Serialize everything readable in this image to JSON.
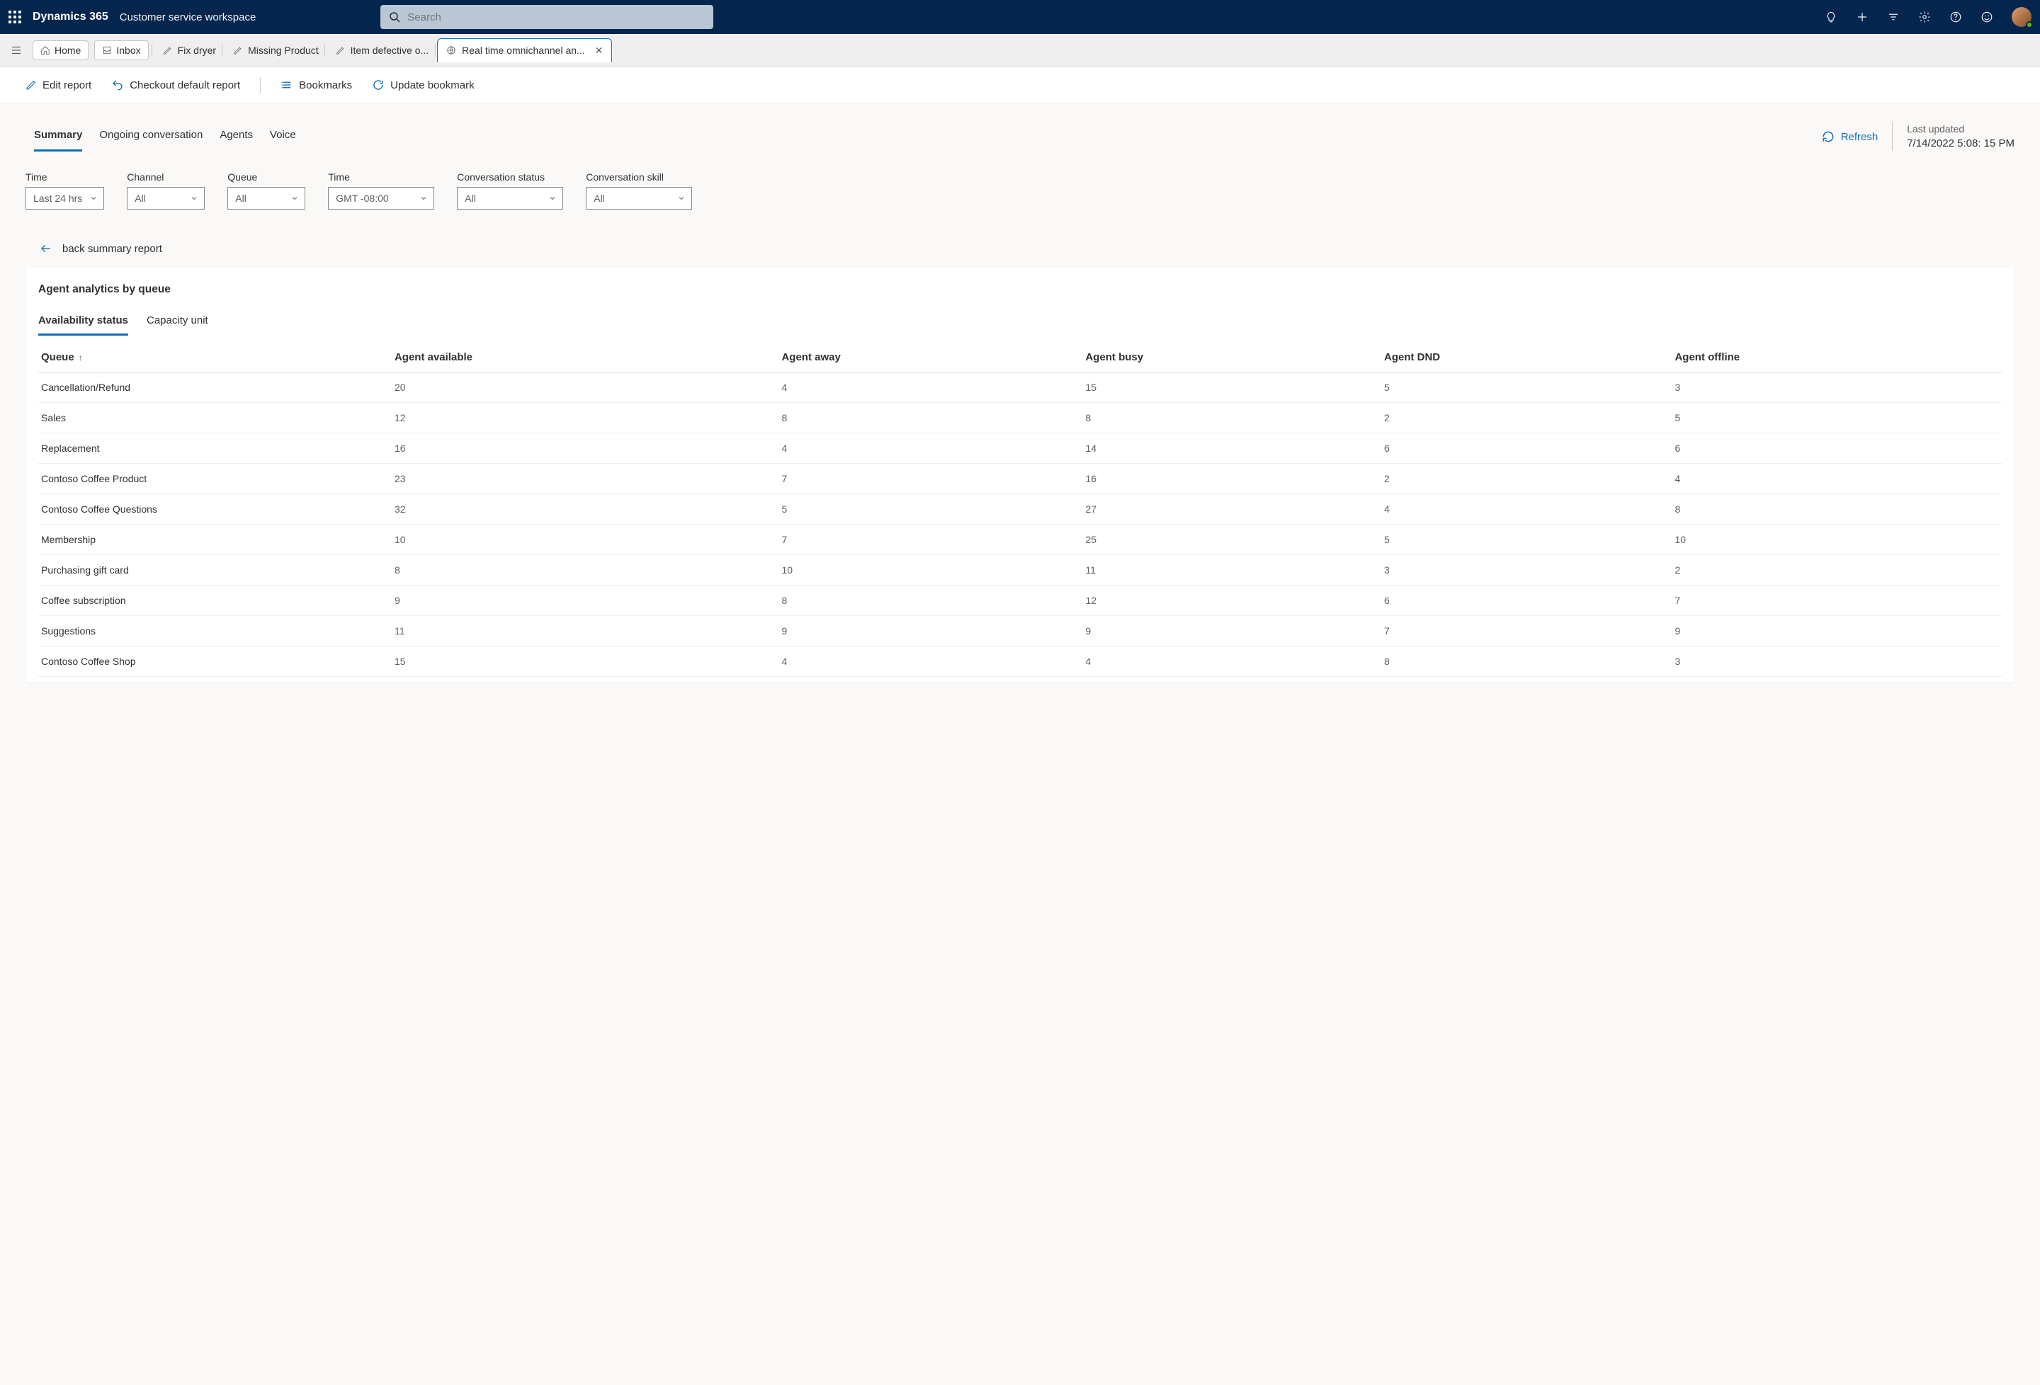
{
  "brand": "Dynamics 365",
  "subbrand": "Customer service workspace",
  "search_placeholder": "Search",
  "pills": {
    "home": "Home",
    "inbox": "Inbox"
  },
  "wtabs": [
    {
      "label": "Fix dryer"
    },
    {
      "label": "Missing Product"
    },
    {
      "label": "Item defective o..."
    },
    {
      "label": "Real time omnichannel an...",
      "active": true
    }
  ],
  "commands": {
    "edit": "Edit report",
    "checkout": "Checkout default report",
    "bookmarks": "Bookmarks",
    "update": "Update bookmark"
  },
  "pivots": [
    "Summary",
    "Ongoing conversation",
    "Agents",
    "Voice"
  ],
  "refresh_label": "Refresh",
  "last_updated_label": "Last updated",
  "last_updated_value": "7/14/2022 5:08: 15 PM",
  "filters": [
    {
      "label": "Time",
      "value": "Last 24 hrs"
    },
    {
      "label": "Channel",
      "value": "All"
    },
    {
      "label": "Queue",
      "value": "All"
    },
    {
      "label": "Time",
      "value": "GMT -08:00",
      "wide": true
    },
    {
      "label": "Conversation status",
      "value": "All",
      "wide": true
    },
    {
      "label": "Conversation skill",
      "value": "All",
      "wide": true
    }
  ],
  "back_text": "back summary report",
  "card_title": "Agent analytics by queue",
  "subtabs": [
    "Availability status",
    "Capacity unit"
  ],
  "columns": [
    "Queue",
    "Agent available",
    "Agent away",
    "Agent busy",
    "Agent DND",
    "Agent offline"
  ],
  "rows": [
    {
      "queue": "Cancellation/Refund",
      "vals": [
        "20",
        "4",
        "15",
        "5",
        "3"
      ]
    },
    {
      "queue": "Sales",
      "vals": [
        "12",
        "8",
        "8",
        "2",
        "5"
      ]
    },
    {
      "queue": "Replacement",
      "vals": [
        "16",
        "4",
        "14",
        "6",
        "6"
      ]
    },
    {
      "queue": "Contoso Coffee Product",
      "vals": [
        "23",
        "7",
        "16",
        "2",
        "4"
      ]
    },
    {
      "queue": "Contoso Coffee Questions",
      "vals": [
        "32",
        "5",
        "27",
        "4",
        "8"
      ]
    },
    {
      "queue": "Membership",
      "vals": [
        "10",
        "7",
        "25",
        "5",
        "10"
      ]
    },
    {
      "queue": "Purchasing gift card",
      "vals": [
        "8",
        "10",
        "11",
        "3",
        "2"
      ]
    },
    {
      "queue": "Coffee subscription",
      "vals": [
        "9",
        "8",
        "12",
        "6",
        "7"
      ]
    },
    {
      "queue": "Suggestions",
      "vals": [
        "11",
        "9",
        "9",
        "7",
        "9"
      ]
    },
    {
      "queue": "Contoso Coffee Shop",
      "vals": [
        "15",
        "4",
        "4",
        "8",
        "3"
      ]
    }
  ]
}
